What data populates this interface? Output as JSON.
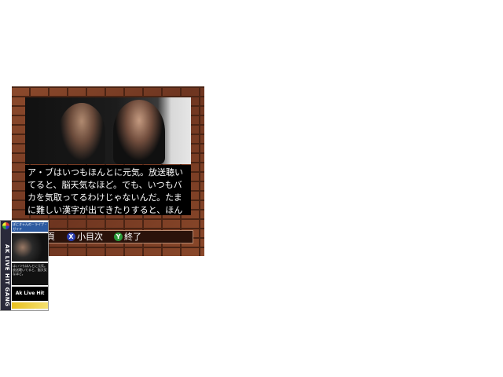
{
  "dialog": {
    "lines": [
      "ア・ブはいつもほんとに元気。放送聴い",
      "てると、脳天気なほど。でも、いつもバ",
      "カを気取ってるわけじゃないんだ。たま",
      "に難しい漢字が出てきたりすると、ほん"
    ]
  },
  "controls": {
    "page_label": "頁",
    "x_button": "X",
    "x_label": "小目次",
    "y_button": "Y",
    "y_label": "終了",
    "x_color": "#2a3cb0",
    "y_color": "#2a9a3a"
  },
  "boxart": {
    "spine_title": "AK LIVE HIT GANG",
    "top_text": "ぽにきゃんの・ライブ・ガイド",
    "blurb": "はいつもほんとに元気。放送聴いてると、脳天気なほど。",
    "title": "Ak Live Hit Gang"
  }
}
